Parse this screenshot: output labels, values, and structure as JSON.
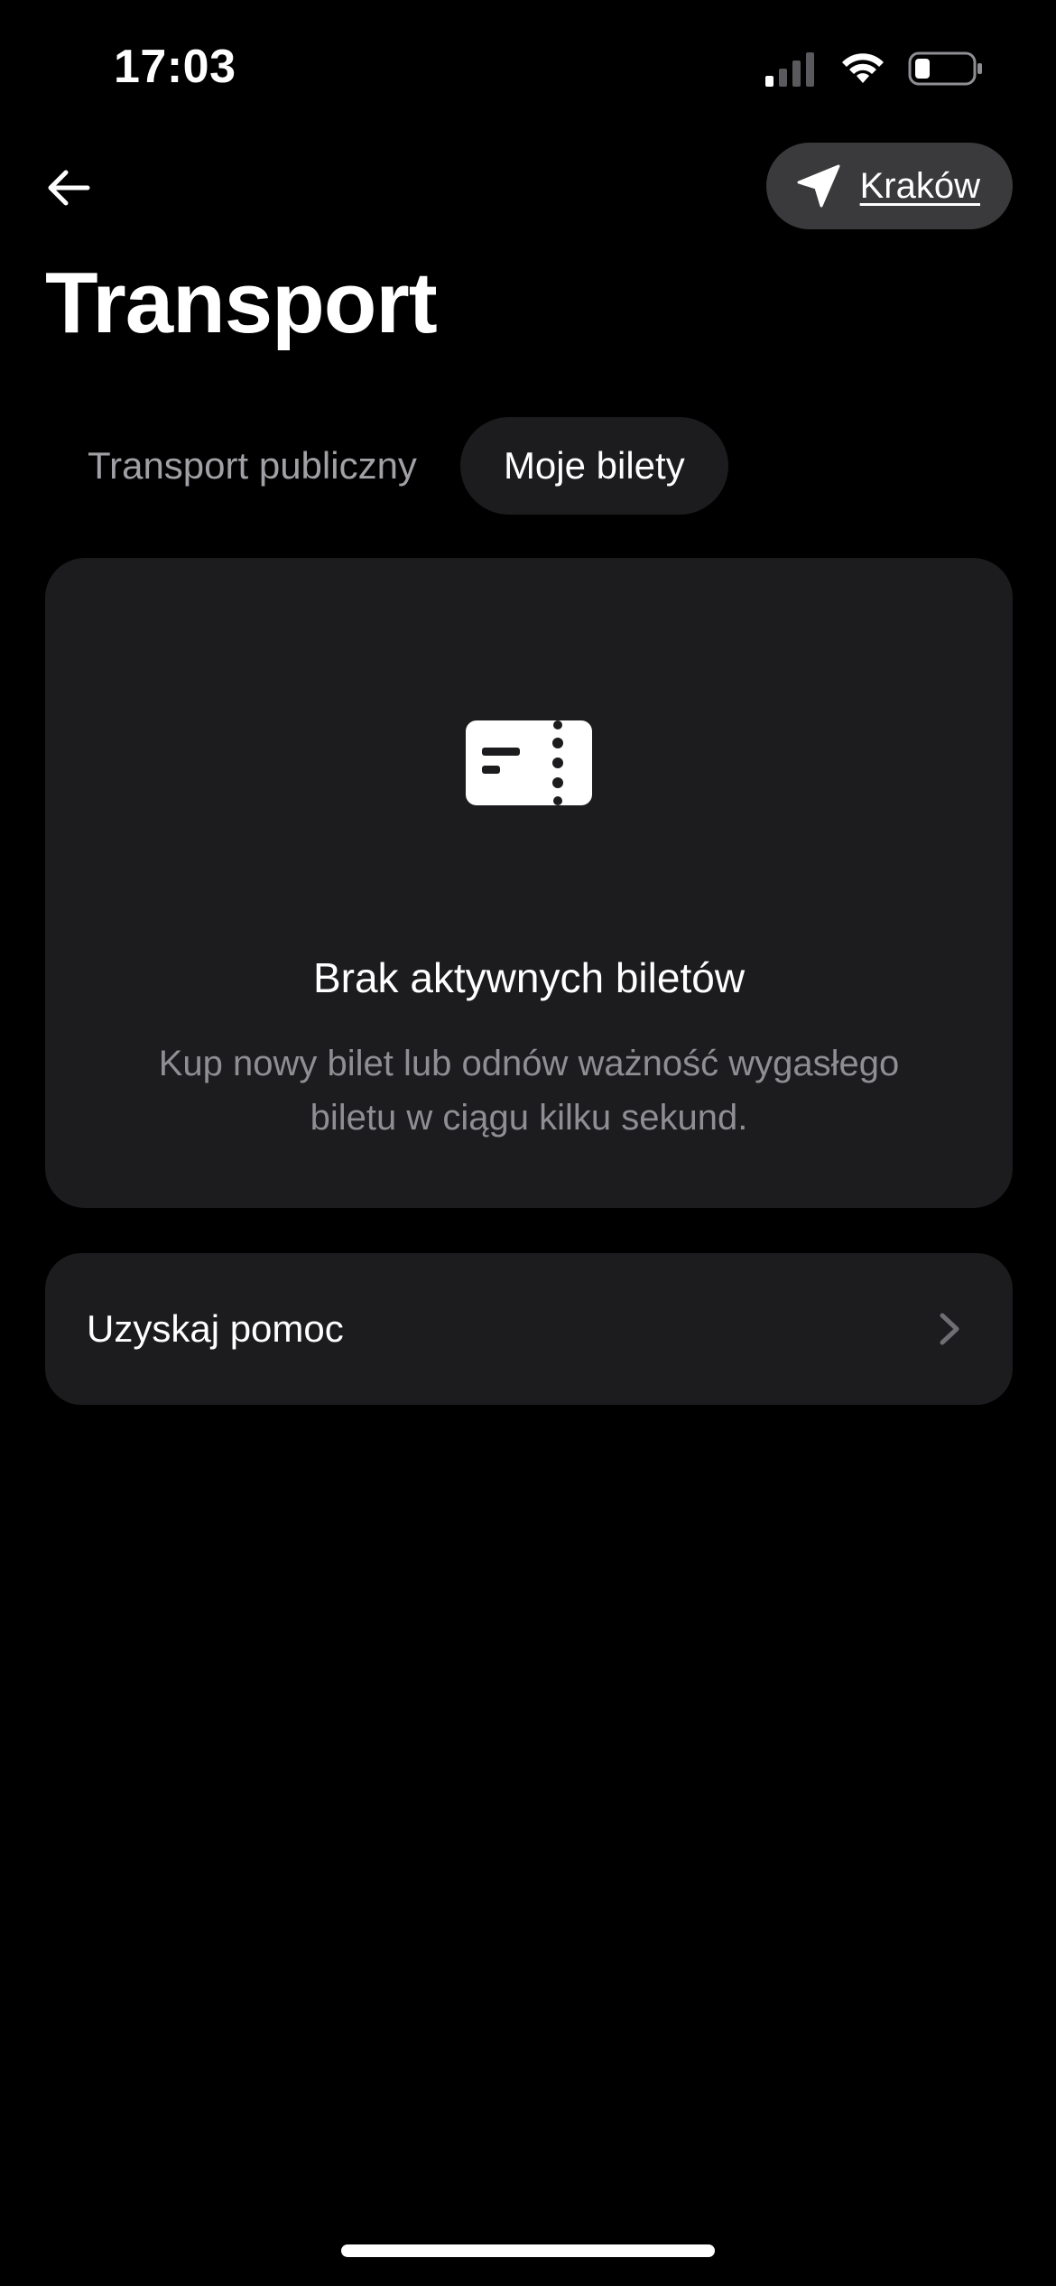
{
  "status_bar": {
    "time": "17:03",
    "icons": [
      "signal-icon",
      "wifi-icon",
      "battery-icon"
    ]
  },
  "header": {
    "back_icon": "arrow-left-icon",
    "location": {
      "icon": "location-arrow-icon",
      "label": "Kraków"
    },
    "title": "Transport"
  },
  "tabs": [
    {
      "label": "Transport publiczny",
      "active": false
    },
    {
      "label": "Moje bilety",
      "active": true
    }
  ],
  "empty_state": {
    "icon": "ticket-icon",
    "title": "Brak aktywnych biletów",
    "description": "Kup nowy bilet lub odnów ważność wygasłego biletu w ciągu kilku sekund."
  },
  "help": {
    "label": "Uzyskaj pomoc",
    "icon": "chevron-right-icon"
  },
  "colors": {
    "background": "#000000",
    "card": "#1c1c1e",
    "pill": "#3a3a3c",
    "text_primary": "#ffffff",
    "text_secondary": "#8e8e93",
    "tab_inactive": "#a0a0a5"
  }
}
